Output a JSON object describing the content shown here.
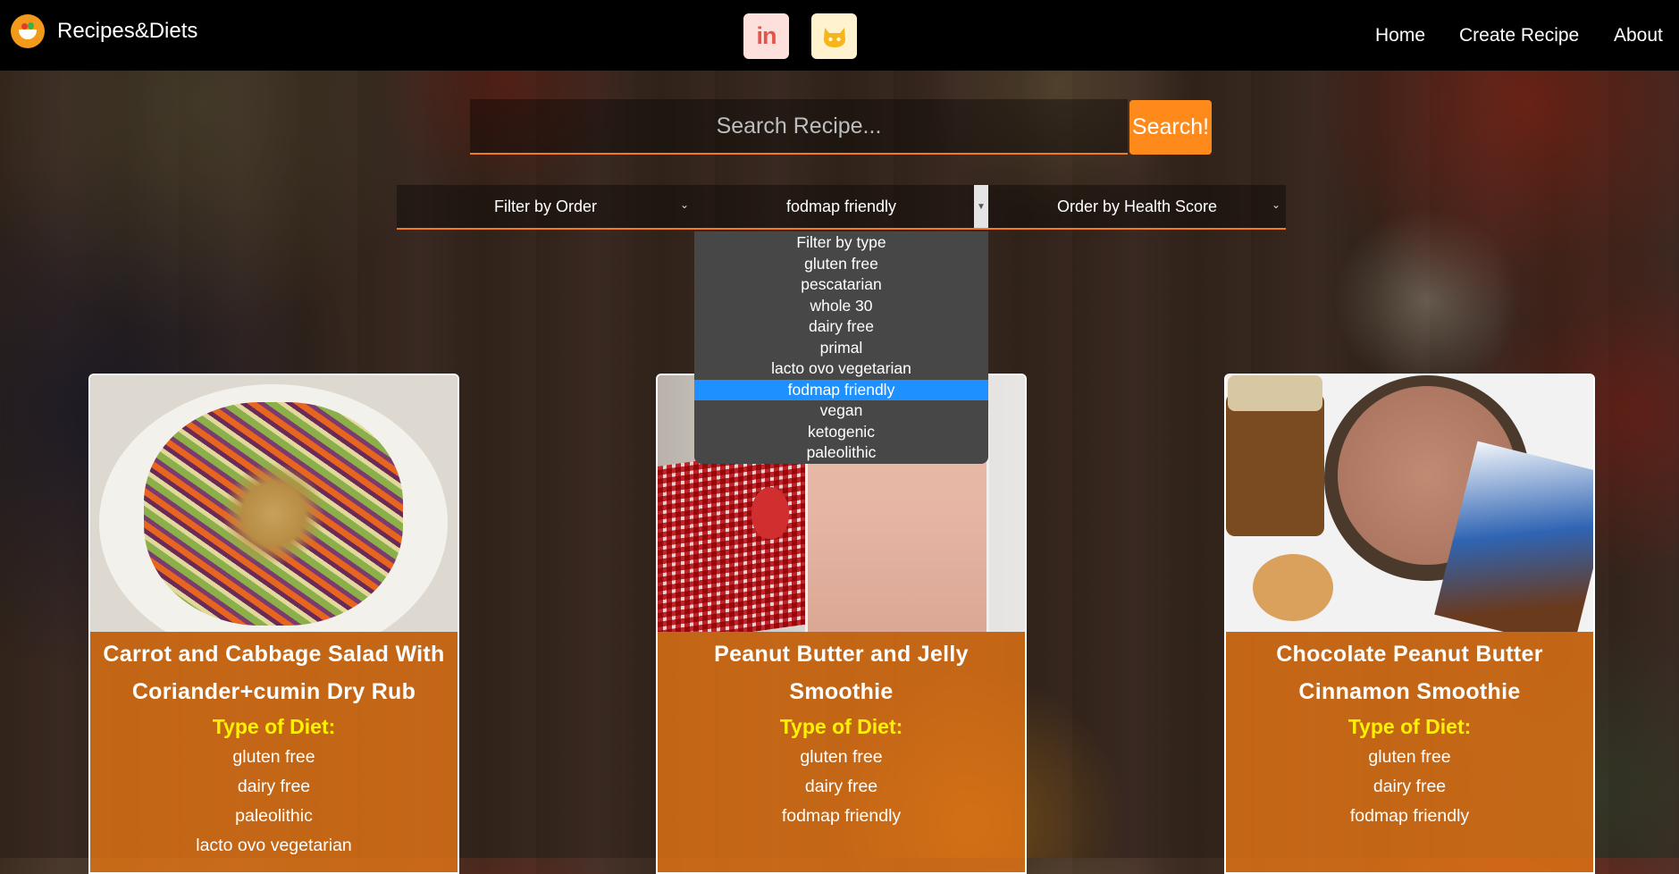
{
  "navbar": {
    "brand_title": "Recipes&Diets",
    "links": [
      "Home",
      "Create Recipe",
      "About"
    ],
    "social_icons": [
      "linkedin-icon",
      "github-icon"
    ]
  },
  "search": {
    "placeholder": "Search Recipe...",
    "button_label": "Search!"
  },
  "filters": {
    "order_label": "Filter by Order",
    "type_selected": "fodmap friendly",
    "health_label": "Order by Health Score",
    "type_options": [
      "Filter by type",
      "gluten free",
      "pescatarian",
      "whole 30",
      "dairy free",
      "primal",
      "lacto ovo vegetarian",
      "fodmap friendly",
      "vegan",
      "ketogenic",
      "paleolithic"
    ],
    "highlight_color": "#1e90ff"
  },
  "cards": [
    {
      "title": "Carrot and Cabbage Salad With Coriander+cumin Dry Rub",
      "diet_label": "Type of Diet:",
      "diets": [
        "gluten free",
        "dairy free",
        "paleolithic",
        "lacto ovo vegetarian"
      ]
    },
    {
      "title": "Peanut Butter and Jelly Smoothie",
      "diet_label": "Type of Diet:",
      "diets": [
        "gluten free",
        "dairy free",
        "fodmap friendly"
      ]
    },
    {
      "title": "Chocolate Peanut Butter Cinnamon Smoothie",
      "diet_label": "Type of Diet:",
      "diets": [
        "gluten free",
        "dairy free",
        "fodmap friendly"
      ]
    }
  ],
  "colors": {
    "accent": "#ff8a1c",
    "card_overlay": "#ec7814",
    "diet_label": "#fff200"
  }
}
